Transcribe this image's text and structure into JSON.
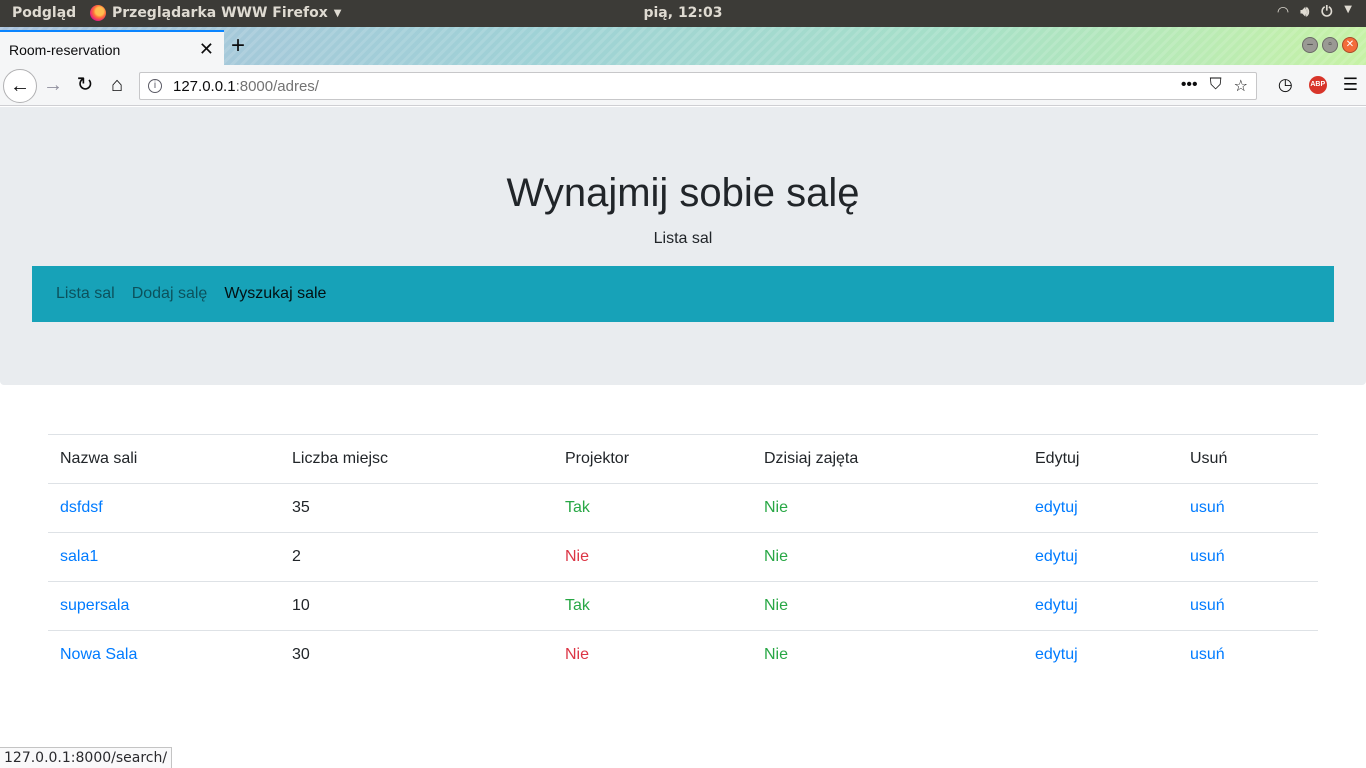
{
  "os_panel": {
    "activities": "Podgląd",
    "app_name": "Przeglądarka WWW Firefox",
    "clock": "pią, 12:03"
  },
  "browser": {
    "tab_title": "Room-reservation",
    "url_host": "127.0.0.1",
    "url_rest": ":8000/adres/",
    "status_url": "127.0.0.1:8000/search/"
  },
  "page": {
    "title": "Wynajmij sobie salę",
    "subtitle": "Lista sal",
    "nav": [
      {
        "label": "Lista sal",
        "active": false
      },
      {
        "label": "Dodaj salę",
        "active": false
      },
      {
        "label": "Wyszukaj sale",
        "active": true
      }
    ],
    "table": {
      "headers": [
        "Nazwa sali",
        "Liczba miejsc",
        "Projektor",
        "Dzisiaj zajęta",
        "Edytuj",
        "Usuń"
      ],
      "rows": [
        {
          "name": "dsfdsf",
          "seats": "35",
          "projector": "Tak",
          "busy": "Nie",
          "edit": "edytuj",
          "delete": "usuń"
        },
        {
          "name": "sala1",
          "seats": "2",
          "projector": "Nie",
          "busy": "Nie",
          "edit": "edytuj",
          "delete": "usuń"
        },
        {
          "name": "supersala",
          "seats": "10",
          "projector": "Tak",
          "busy": "Nie",
          "edit": "edytuj",
          "delete": "usuń"
        },
        {
          "name": "Nowa Sala",
          "seats": "30",
          "projector": "Nie",
          "busy": "Nie",
          "edit": "edytuj",
          "delete": "usuń"
        }
      ]
    }
  },
  "colors": {
    "nav_bg": "#17a2b8",
    "jumbotron_bg": "#e9ecef",
    "link": "#007bff",
    "yes": "#28a745",
    "no": "#dc3545"
  }
}
